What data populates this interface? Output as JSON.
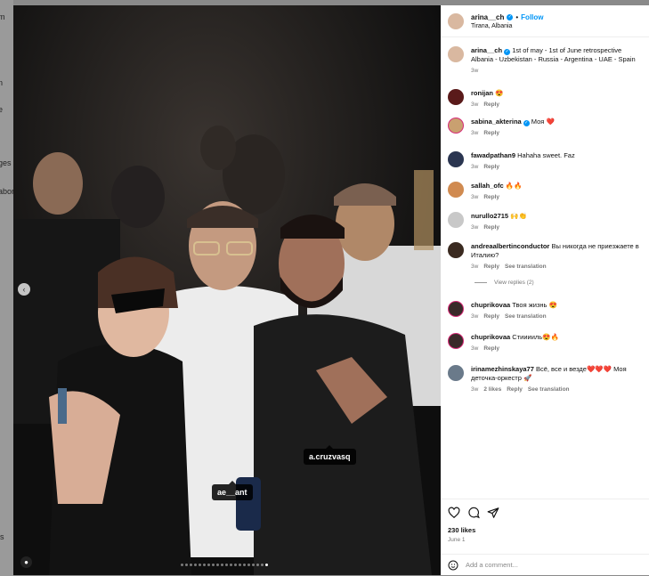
{
  "background_fragments": [
    "m",
    "n",
    "e",
    "ges",
    "abor",
    "ls"
  ],
  "photo": {
    "tags": [
      "a.cruzvasq",
      "ae__ant"
    ],
    "prev_glyph": "‹",
    "user_glyph": "●",
    "carousel": {
      "total": 20,
      "active_index": 19
    }
  },
  "post": {
    "author": "arina__ch",
    "follow_label": "Follow",
    "separator": "•",
    "location": "Tirana, Albania",
    "caption_line1": "1st of may - 1st of June retrospective",
    "caption_line2": "Albania - Uzbekistan - Russia - Argentina - UAE - Spain",
    "caption_time": "3w",
    "likes": "230 likes",
    "date": "June 1"
  },
  "comments": [
    {
      "user": "ronijan",
      "text": "😍",
      "time": "3w",
      "actions": [
        "Reply"
      ],
      "verified": false,
      "ring": false,
      "avatar_color": "#5a1a1a"
    },
    {
      "user": "sabina_akterina",
      "text": "Моя ❤️",
      "time": "3w",
      "actions": [
        "Reply"
      ],
      "verified": true,
      "ring": true,
      "avatar_color": "#c9a070"
    },
    {
      "user": "fawadpathan9",
      "text": "Hahaha sweet. Faz",
      "time": "3w",
      "actions": [
        "Reply"
      ],
      "verified": false,
      "ring": false,
      "avatar_color": "#2a3550"
    },
    {
      "user": "sallah_ofc",
      "text": "🔥🔥",
      "time": "3w",
      "actions": [
        "Reply"
      ],
      "verified": false,
      "ring": false,
      "avatar_color": "#d08a50"
    },
    {
      "user": "nurullo2715",
      "text": "🙌👏",
      "time": "3w",
      "actions": [
        "Reply"
      ],
      "verified": false,
      "ring": false,
      "avatar_color": "#c8c8c8"
    },
    {
      "user": "andreaalbertinconductor",
      "text": "Вы никогда не приезжаете в Италию?",
      "time": "3w",
      "actions": [
        "Reply",
        "See translation"
      ],
      "verified": false,
      "ring": false,
      "avatar_color": "#3a2a20"
    },
    {
      "user": "chuprikovaa",
      "text": "Твоя жизнь 😍",
      "time": "3w",
      "actions": [
        "Reply",
        "See translation"
      ],
      "verified": false,
      "ring": true,
      "avatar_color": "#3a2a2a"
    },
    {
      "user": "chuprikovaa",
      "text": "Стииииль😍🔥",
      "time": "3w",
      "actions": [
        "Reply"
      ],
      "verified": false,
      "ring": true,
      "avatar_color": "#3a2a2a"
    },
    {
      "user": "irinamezhinskaya77",
      "text": "Всё, все и везде❤️❤️❤️ Моя деточка-оркестр 🚀",
      "time": "3w",
      "actions": [
        "2 likes",
        "Reply",
        "See translation"
      ],
      "verified": false,
      "ring": false,
      "avatar_color": "#6a7a8a"
    }
  ],
  "view_replies_label": "View replies (2)",
  "add_comment_placeholder": "Add a comment..."
}
